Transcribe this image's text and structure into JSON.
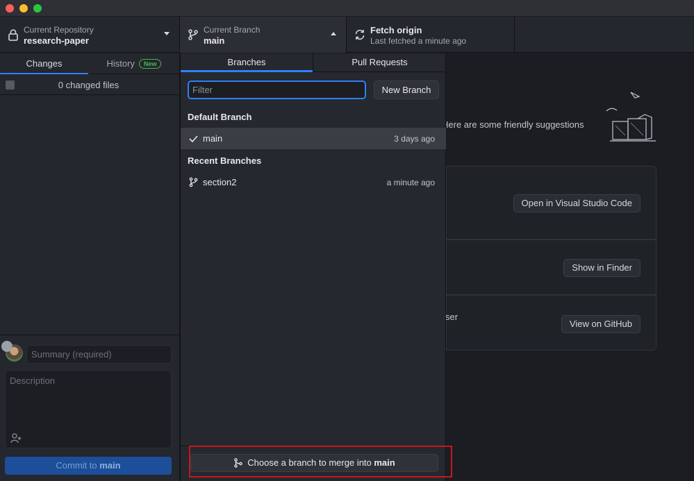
{
  "toolbar": {
    "repo_label": "Current Repository",
    "repo_value": "research-paper",
    "branch_label": "Current Branch",
    "branch_value": "main",
    "fetch_title": "Fetch origin",
    "fetch_sub": "Last fetched a minute ago"
  },
  "sidebar": {
    "tabs": [
      {
        "label": "Changes"
      },
      {
        "label": "History",
        "badge": "New"
      }
    ],
    "changed_files": "0 changed files",
    "summary_placeholder": "Summary (required)",
    "description_placeholder": "Description",
    "commit_prefix": "Commit to ",
    "commit_branch": "main"
  },
  "branches_panel": {
    "tabs": [
      "Branches",
      "Pull Requests"
    ],
    "filter_placeholder": "Filter",
    "new_branch_label": "New Branch",
    "default_title": "Default Branch",
    "default_branches": [
      {
        "name": "main",
        "time": "3 days ago",
        "selected": true
      }
    ],
    "recent_title": "Recent Branches",
    "recent_branches": [
      {
        "name": "section2",
        "time": "a minute ago"
      }
    ],
    "merge_prefix": "Choose a branch to merge into ",
    "merge_branch": "main"
  },
  "main": {
    "suggestions_text": "Here are some friendly suggestions",
    "partial_text": "ser",
    "buttons": [
      "Open in Visual Studio Code",
      "Show in Finder",
      "View on GitHub"
    ]
  },
  "colors": {
    "accent": "#2f81f7",
    "highlight_box": "#c8161d",
    "badge_green": "#3fb950"
  }
}
